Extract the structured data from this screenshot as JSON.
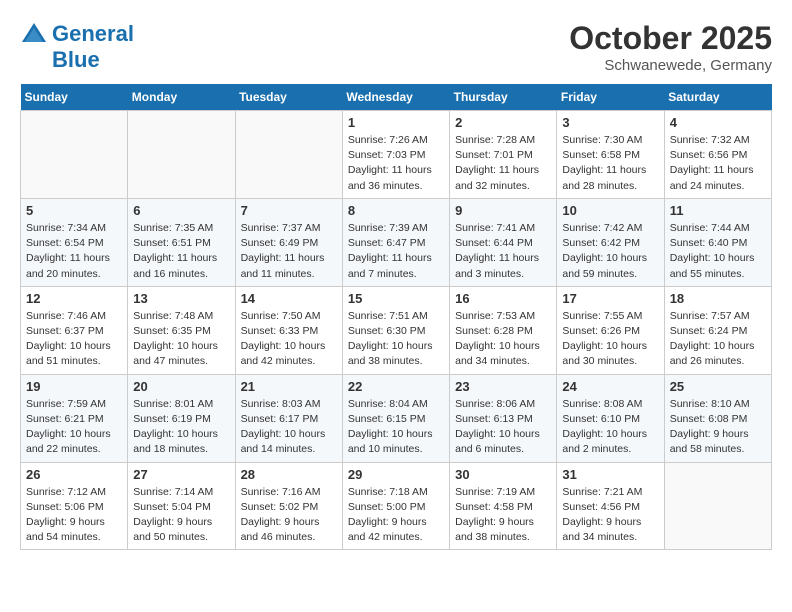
{
  "header": {
    "logo_line1": "General",
    "logo_line2": "Blue",
    "month": "October 2025",
    "location": "Schwanewede, Germany"
  },
  "weekdays": [
    "Sunday",
    "Monday",
    "Tuesday",
    "Wednesday",
    "Thursday",
    "Friday",
    "Saturday"
  ],
  "weeks": [
    [
      {
        "day": "",
        "sunrise": "",
        "sunset": "",
        "daylight": ""
      },
      {
        "day": "",
        "sunrise": "",
        "sunset": "",
        "daylight": ""
      },
      {
        "day": "",
        "sunrise": "",
        "sunset": "",
        "daylight": ""
      },
      {
        "day": "1",
        "sunrise": "Sunrise: 7:26 AM",
        "sunset": "Sunset: 7:03 PM",
        "daylight": "Daylight: 11 hours and 36 minutes."
      },
      {
        "day": "2",
        "sunrise": "Sunrise: 7:28 AM",
        "sunset": "Sunset: 7:01 PM",
        "daylight": "Daylight: 11 hours and 32 minutes."
      },
      {
        "day": "3",
        "sunrise": "Sunrise: 7:30 AM",
        "sunset": "Sunset: 6:58 PM",
        "daylight": "Daylight: 11 hours and 28 minutes."
      },
      {
        "day": "4",
        "sunrise": "Sunrise: 7:32 AM",
        "sunset": "Sunset: 6:56 PM",
        "daylight": "Daylight: 11 hours and 24 minutes."
      }
    ],
    [
      {
        "day": "5",
        "sunrise": "Sunrise: 7:34 AM",
        "sunset": "Sunset: 6:54 PM",
        "daylight": "Daylight: 11 hours and 20 minutes."
      },
      {
        "day": "6",
        "sunrise": "Sunrise: 7:35 AM",
        "sunset": "Sunset: 6:51 PM",
        "daylight": "Daylight: 11 hours and 16 minutes."
      },
      {
        "day": "7",
        "sunrise": "Sunrise: 7:37 AM",
        "sunset": "Sunset: 6:49 PM",
        "daylight": "Daylight: 11 hours and 11 minutes."
      },
      {
        "day": "8",
        "sunrise": "Sunrise: 7:39 AM",
        "sunset": "Sunset: 6:47 PM",
        "daylight": "Daylight: 11 hours and 7 minutes."
      },
      {
        "day": "9",
        "sunrise": "Sunrise: 7:41 AM",
        "sunset": "Sunset: 6:44 PM",
        "daylight": "Daylight: 11 hours and 3 minutes."
      },
      {
        "day": "10",
        "sunrise": "Sunrise: 7:42 AM",
        "sunset": "Sunset: 6:42 PM",
        "daylight": "Daylight: 10 hours and 59 minutes."
      },
      {
        "day": "11",
        "sunrise": "Sunrise: 7:44 AM",
        "sunset": "Sunset: 6:40 PM",
        "daylight": "Daylight: 10 hours and 55 minutes."
      }
    ],
    [
      {
        "day": "12",
        "sunrise": "Sunrise: 7:46 AM",
        "sunset": "Sunset: 6:37 PM",
        "daylight": "Daylight: 10 hours and 51 minutes."
      },
      {
        "day": "13",
        "sunrise": "Sunrise: 7:48 AM",
        "sunset": "Sunset: 6:35 PM",
        "daylight": "Daylight: 10 hours and 47 minutes."
      },
      {
        "day": "14",
        "sunrise": "Sunrise: 7:50 AM",
        "sunset": "Sunset: 6:33 PM",
        "daylight": "Daylight: 10 hours and 42 minutes."
      },
      {
        "day": "15",
        "sunrise": "Sunrise: 7:51 AM",
        "sunset": "Sunset: 6:30 PM",
        "daylight": "Daylight: 10 hours and 38 minutes."
      },
      {
        "day": "16",
        "sunrise": "Sunrise: 7:53 AM",
        "sunset": "Sunset: 6:28 PM",
        "daylight": "Daylight: 10 hours and 34 minutes."
      },
      {
        "day": "17",
        "sunrise": "Sunrise: 7:55 AM",
        "sunset": "Sunset: 6:26 PM",
        "daylight": "Daylight: 10 hours and 30 minutes."
      },
      {
        "day": "18",
        "sunrise": "Sunrise: 7:57 AM",
        "sunset": "Sunset: 6:24 PM",
        "daylight": "Daylight: 10 hours and 26 minutes."
      }
    ],
    [
      {
        "day": "19",
        "sunrise": "Sunrise: 7:59 AM",
        "sunset": "Sunset: 6:21 PM",
        "daylight": "Daylight: 10 hours and 22 minutes."
      },
      {
        "day": "20",
        "sunrise": "Sunrise: 8:01 AM",
        "sunset": "Sunset: 6:19 PM",
        "daylight": "Daylight: 10 hours and 18 minutes."
      },
      {
        "day": "21",
        "sunrise": "Sunrise: 8:03 AM",
        "sunset": "Sunset: 6:17 PM",
        "daylight": "Daylight: 10 hours and 14 minutes."
      },
      {
        "day": "22",
        "sunrise": "Sunrise: 8:04 AM",
        "sunset": "Sunset: 6:15 PM",
        "daylight": "Daylight: 10 hours and 10 minutes."
      },
      {
        "day": "23",
        "sunrise": "Sunrise: 8:06 AM",
        "sunset": "Sunset: 6:13 PM",
        "daylight": "Daylight: 10 hours and 6 minutes."
      },
      {
        "day": "24",
        "sunrise": "Sunrise: 8:08 AM",
        "sunset": "Sunset: 6:10 PM",
        "daylight": "Daylight: 10 hours and 2 minutes."
      },
      {
        "day": "25",
        "sunrise": "Sunrise: 8:10 AM",
        "sunset": "Sunset: 6:08 PM",
        "daylight": "Daylight: 9 hours and 58 minutes."
      }
    ],
    [
      {
        "day": "26",
        "sunrise": "Sunrise: 7:12 AM",
        "sunset": "Sunset: 5:06 PM",
        "daylight": "Daylight: 9 hours and 54 minutes."
      },
      {
        "day": "27",
        "sunrise": "Sunrise: 7:14 AM",
        "sunset": "Sunset: 5:04 PM",
        "daylight": "Daylight: 9 hours and 50 minutes."
      },
      {
        "day": "28",
        "sunrise": "Sunrise: 7:16 AM",
        "sunset": "Sunset: 5:02 PM",
        "daylight": "Daylight: 9 hours and 46 minutes."
      },
      {
        "day": "29",
        "sunrise": "Sunrise: 7:18 AM",
        "sunset": "Sunset: 5:00 PM",
        "daylight": "Daylight: 9 hours and 42 minutes."
      },
      {
        "day": "30",
        "sunrise": "Sunrise: 7:19 AM",
        "sunset": "Sunset: 4:58 PM",
        "daylight": "Daylight: 9 hours and 38 minutes."
      },
      {
        "day": "31",
        "sunrise": "Sunrise: 7:21 AM",
        "sunset": "Sunset: 4:56 PM",
        "daylight": "Daylight: 9 hours and 34 minutes."
      },
      {
        "day": "",
        "sunrise": "",
        "sunset": "",
        "daylight": ""
      }
    ]
  ]
}
